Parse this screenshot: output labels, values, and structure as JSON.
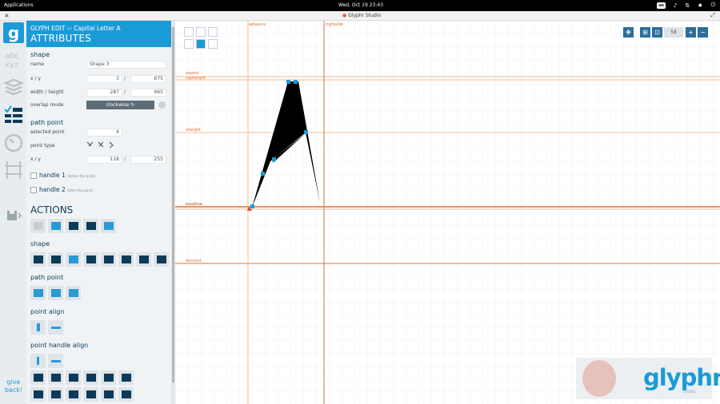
{
  "system": {
    "apps_label": "Applications",
    "clock": "Wed, Oct 19   23:43",
    "keyboard": "us"
  },
  "window": {
    "title": "Glyphr Studio",
    "close": "×"
  },
  "nav": {
    "logo": "g",
    "give_back": "give back!"
  },
  "panel": {
    "crumb_left": "GLYPH EDIT",
    "crumb_sep": "››",
    "crumb_right": "Capital Letter A",
    "title": "ATTRIBUTES",
    "shape": {
      "heading": "shape",
      "name_label": "name",
      "name_value": "Shape 3",
      "xy_label": "x / y",
      "x_value": "3",
      "y_value": "675",
      "wh_label": "width / height",
      "w_value": "287",
      "h_value": "665",
      "overlap_label": "overlap mode",
      "overlap_value": "clockwise ↻"
    },
    "path_point": {
      "heading": "path point",
      "selected_label": "selected point",
      "selected_value": "4",
      "type_label": "point type",
      "xy_label": "x / y",
      "x_value": "118",
      "y_value": "255"
    },
    "handle1": {
      "label": "handle 1",
      "note": "(before the point)"
    },
    "handle2": {
      "label": "handle 2",
      "note": "(after the point)"
    },
    "actions": {
      "heading": "ACTIONS",
      "shape_heading": "shape",
      "path_point_heading": "path point",
      "point_align_heading": "point align",
      "point_handle_align_heading": "point handle align"
    }
  },
  "canvas": {
    "zoom_value": "58",
    "guides": {
      "advance": "advance",
      "ascent": "ascent",
      "capheight": "capheight",
      "xheight": "xheight",
      "baseline": "baseline",
      "descent": "descent",
      "advance_right": "rightside"
    },
    "brand": "glyphr",
    "brand_sub": "STUDIO"
  }
}
